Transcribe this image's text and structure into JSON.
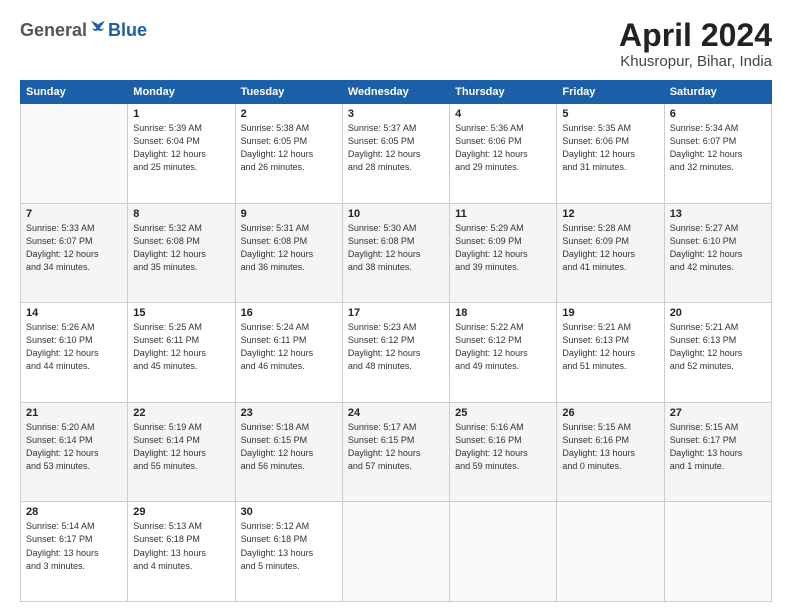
{
  "header": {
    "logo_general": "General",
    "logo_blue": "Blue",
    "month_title": "April 2024",
    "location": "Khusropur, Bihar, India"
  },
  "columns": [
    "Sunday",
    "Monday",
    "Tuesday",
    "Wednesday",
    "Thursday",
    "Friday",
    "Saturday"
  ],
  "weeks": [
    [
      {
        "day": "",
        "info": ""
      },
      {
        "day": "1",
        "info": "Sunrise: 5:39 AM\nSunset: 6:04 PM\nDaylight: 12 hours\nand 25 minutes."
      },
      {
        "day": "2",
        "info": "Sunrise: 5:38 AM\nSunset: 6:05 PM\nDaylight: 12 hours\nand 26 minutes."
      },
      {
        "day": "3",
        "info": "Sunrise: 5:37 AM\nSunset: 6:05 PM\nDaylight: 12 hours\nand 28 minutes."
      },
      {
        "day": "4",
        "info": "Sunrise: 5:36 AM\nSunset: 6:06 PM\nDaylight: 12 hours\nand 29 minutes."
      },
      {
        "day": "5",
        "info": "Sunrise: 5:35 AM\nSunset: 6:06 PM\nDaylight: 12 hours\nand 31 minutes."
      },
      {
        "day": "6",
        "info": "Sunrise: 5:34 AM\nSunset: 6:07 PM\nDaylight: 12 hours\nand 32 minutes."
      }
    ],
    [
      {
        "day": "7",
        "info": "Sunrise: 5:33 AM\nSunset: 6:07 PM\nDaylight: 12 hours\nand 34 minutes."
      },
      {
        "day": "8",
        "info": "Sunrise: 5:32 AM\nSunset: 6:08 PM\nDaylight: 12 hours\nand 35 minutes."
      },
      {
        "day": "9",
        "info": "Sunrise: 5:31 AM\nSunset: 6:08 PM\nDaylight: 12 hours\nand 36 minutes."
      },
      {
        "day": "10",
        "info": "Sunrise: 5:30 AM\nSunset: 6:08 PM\nDaylight: 12 hours\nand 38 minutes."
      },
      {
        "day": "11",
        "info": "Sunrise: 5:29 AM\nSunset: 6:09 PM\nDaylight: 12 hours\nand 39 minutes."
      },
      {
        "day": "12",
        "info": "Sunrise: 5:28 AM\nSunset: 6:09 PM\nDaylight: 12 hours\nand 41 minutes."
      },
      {
        "day": "13",
        "info": "Sunrise: 5:27 AM\nSunset: 6:10 PM\nDaylight: 12 hours\nand 42 minutes."
      }
    ],
    [
      {
        "day": "14",
        "info": "Sunrise: 5:26 AM\nSunset: 6:10 PM\nDaylight: 12 hours\nand 44 minutes."
      },
      {
        "day": "15",
        "info": "Sunrise: 5:25 AM\nSunset: 6:11 PM\nDaylight: 12 hours\nand 45 minutes."
      },
      {
        "day": "16",
        "info": "Sunrise: 5:24 AM\nSunset: 6:11 PM\nDaylight: 12 hours\nand 46 minutes."
      },
      {
        "day": "17",
        "info": "Sunrise: 5:23 AM\nSunset: 6:12 PM\nDaylight: 12 hours\nand 48 minutes."
      },
      {
        "day": "18",
        "info": "Sunrise: 5:22 AM\nSunset: 6:12 PM\nDaylight: 12 hours\nand 49 minutes."
      },
      {
        "day": "19",
        "info": "Sunrise: 5:21 AM\nSunset: 6:13 PM\nDaylight: 12 hours\nand 51 minutes."
      },
      {
        "day": "20",
        "info": "Sunrise: 5:21 AM\nSunset: 6:13 PM\nDaylight: 12 hours\nand 52 minutes."
      }
    ],
    [
      {
        "day": "21",
        "info": "Sunrise: 5:20 AM\nSunset: 6:14 PM\nDaylight: 12 hours\nand 53 minutes."
      },
      {
        "day": "22",
        "info": "Sunrise: 5:19 AM\nSunset: 6:14 PM\nDaylight: 12 hours\nand 55 minutes."
      },
      {
        "day": "23",
        "info": "Sunrise: 5:18 AM\nSunset: 6:15 PM\nDaylight: 12 hours\nand 56 minutes."
      },
      {
        "day": "24",
        "info": "Sunrise: 5:17 AM\nSunset: 6:15 PM\nDaylight: 12 hours\nand 57 minutes."
      },
      {
        "day": "25",
        "info": "Sunrise: 5:16 AM\nSunset: 6:16 PM\nDaylight: 12 hours\nand 59 minutes."
      },
      {
        "day": "26",
        "info": "Sunrise: 5:15 AM\nSunset: 6:16 PM\nDaylight: 13 hours\nand 0 minutes."
      },
      {
        "day": "27",
        "info": "Sunrise: 5:15 AM\nSunset: 6:17 PM\nDaylight: 13 hours\nand 1 minute."
      }
    ],
    [
      {
        "day": "28",
        "info": "Sunrise: 5:14 AM\nSunset: 6:17 PM\nDaylight: 13 hours\nand 3 minutes."
      },
      {
        "day": "29",
        "info": "Sunrise: 5:13 AM\nSunset: 6:18 PM\nDaylight: 13 hours\nand 4 minutes."
      },
      {
        "day": "30",
        "info": "Sunrise: 5:12 AM\nSunset: 6:18 PM\nDaylight: 13 hours\nand 5 minutes."
      },
      {
        "day": "",
        "info": ""
      },
      {
        "day": "",
        "info": ""
      },
      {
        "day": "",
        "info": ""
      },
      {
        "day": "",
        "info": ""
      }
    ]
  ]
}
